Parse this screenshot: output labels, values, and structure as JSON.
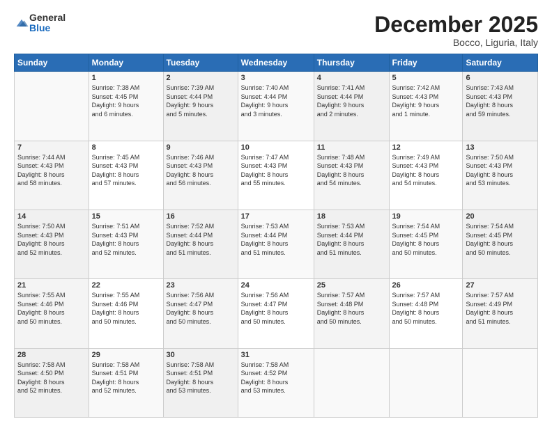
{
  "header": {
    "logo_general": "General",
    "logo_blue": "Blue",
    "month_title": "December 2025",
    "location": "Bocco, Liguria, Italy"
  },
  "days_of_week": [
    "Sunday",
    "Monday",
    "Tuesday",
    "Wednesday",
    "Thursday",
    "Friday",
    "Saturday"
  ],
  "weeks": [
    [
      {
        "day": "",
        "info": ""
      },
      {
        "day": "1",
        "info": "Sunrise: 7:38 AM\nSunset: 4:45 PM\nDaylight: 9 hours\nand 6 minutes."
      },
      {
        "day": "2",
        "info": "Sunrise: 7:39 AM\nSunset: 4:44 PM\nDaylight: 9 hours\nand 5 minutes."
      },
      {
        "day": "3",
        "info": "Sunrise: 7:40 AM\nSunset: 4:44 PM\nDaylight: 9 hours\nand 3 minutes."
      },
      {
        "day": "4",
        "info": "Sunrise: 7:41 AM\nSunset: 4:44 PM\nDaylight: 9 hours\nand 2 minutes."
      },
      {
        "day": "5",
        "info": "Sunrise: 7:42 AM\nSunset: 4:43 PM\nDaylight: 9 hours\nand 1 minute."
      },
      {
        "day": "6",
        "info": "Sunrise: 7:43 AM\nSunset: 4:43 PM\nDaylight: 8 hours\nand 59 minutes."
      }
    ],
    [
      {
        "day": "7",
        "info": "Sunrise: 7:44 AM\nSunset: 4:43 PM\nDaylight: 8 hours\nand 58 minutes."
      },
      {
        "day": "8",
        "info": "Sunrise: 7:45 AM\nSunset: 4:43 PM\nDaylight: 8 hours\nand 57 minutes."
      },
      {
        "day": "9",
        "info": "Sunrise: 7:46 AM\nSunset: 4:43 PM\nDaylight: 8 hours\nand 56 minutes."
      },
      {
        "day": "10",
        "info": "Sunrise: 7:47 AM\nSunset: 4:43 PM\nDaylight: 8 hours\nand 55 minutes."
      },
      {
        "day": "11",
        "info": "Sunrise: 7:48 AM\nSunset: 4:43 PM\nDaylight: 8 hours\nand 54 minutes."
      },
      {
        "day": "12",
        "info": "Sunrise: 7:49 AM\nSunset: 4:43 PM\nDaylight: 8 hours\nand 54 minutes."
      },
      {
        "day": "13",
        "info": "Sunrise: 7:50 AM\nSunset: 4:43 PM\nDaylight: 8 hours\nand 53 minutes."
      }
    ],
    [
      {
        "day": "14",
        "info": "Sunrise: 7:50 AM\nSunset: 4:43 PM\nDaylight: 8 hours\nand 52 minutes."
      },
      {
        "day": "15",
        "info": "Sunrise: 7:51 AM\nSunset: 4:43 PM\nDaylight: 8 hours\nand 52 minutes."
      },
      {
        "day": "16",
        "info": "Sunrise: 7:52 AM\nSunset: 4:44 PM\nDaylight: 8 hours\nand 51 minutes."
      },
      {
        "day": "17",
        "info": "Sunrise: 7:53 AM\nSunset: 4:44 PM\nDaylight: 8 hours\nand 51 minutes."
      },
      {
        "day": "18",
        "info": "Sunrise: 7:53 AM\nSunset: 4:44 PM\nDaylight: 8 hours\nand 51 minutes."
      },
      {
        "day": "19",
        "info": "Sunrise: 7:54 AM\nSunset: 4:45 PM\nDaylight: 8 hours\nand 50 minutes."
      },
      {
        "day": "20",
        "info": "Sunrise: 7:54 AM\nSunset: 4:45 PM\nDaylight: 8 hours\nand 50 minutes."
      }
    ],
    [
      {
        "day": "21",
        "info": "Sunrise: 7:55 AM\nSunset: 4:46 PM\nDaylight: 8 hours\nand 50 minutes."
      },
      {
        "day": "22",
        "info": "Sunrise: 7:55 AM\nSunset: 4:46 PM\nDaylight: 8 hours\nand 50 minutes."
      },
      {
        "day": "23",
        "info": "Sunrise: 7:56 AM\nSunset: 4:47 PM\nDaylight: 8 hours\nand 50 minutes."
      },
      {
        "day": "24",
        "info": "Sunrise: 7:56 AM\nSunset: 4:47 PM\nDaylight: 8 hours\nand 50 minutes."
      },
      {
        "day": "25",
        "info": "Sunrise: 7:57 AM\nSunset: 4:48 PM\nDaylight: 8 hours\nand 50 minutes."
      },
      {
        "day": "26",
        "info": "Sunrise: 7:57 AM\nSunset: 4:48 PM\nDaylight: 8 hours\nand 50 minutes."
      },
      {
        "day": "27",
        "info": "Sunrise: 7:57 AM\nSunset: 4:49 PM\nDaylight: 8 hours\nand 51 minutes."
      }
    ],
    [
      {
        "day": "28",
        "info": "Sunrise: 7:58 AM\nSunset: 4:50 PM\nDaylight: 8 hours\nand 52 minutes."
      },
      {
        "day": "29",
        "info": "Sunrise: 7:58 AM\nSunset: 4:51 PM\nDaylight: 8 hours\nand 52 minutes."
      },
      {
        "day": "30",
        "info": "Sunrise: 7:58 AM\nSunset: 4:51 PM\nDaylight: 8 hours\nand 53 minutes."
      },
      {
        "day": "31",
        "info": "Sunrise: 7:58 AM\nSunset: 4:52 PM\nDaylight: 8 hours\nand 53 minutes."
      },
      {
        "day": "",
        "info": ""
      },
      {
        "day": "",
        "info": ""
      },
      {
        "day": "",
        "info": ""
      }
    ]
  ]
}
